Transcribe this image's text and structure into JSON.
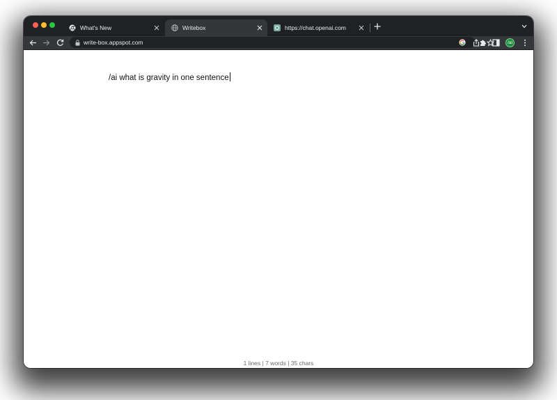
{
  "window": {
    "traffic_colors": {
      "close": "#ff5f57",
      "minimize": "#febc2e",
      "zoom": "#28c840"
    }
  },
  "tabs": [
    {
      "title": "What's New",
      "icon": "chrome-icon",
      "active": false
    },
    {
      "title": "Writebox",
      "icon": "globe-icon",
      "active": true
    },
    {
      "title": "https://chat.openai.com",
      "icon": "openai-icon",
      "active": false
    }
  ],
  "toolbar": {
    "url": "write-box.appspot.com",
    "avatar_label": "/ai",
    "icons": [
      "back-icon",
      "forward-icon",
      "reload-icon",
      "lock-icon",
      "google-icon",
      "share-icon",
      "star-icon",
      "extensions-icon",
      "side-panel-icon",
      "menu-icon"
    ]
  },
  "editor": {
    "text": "/ai what is gravity in one sentence"
  },
  "status": {
    "text": "1 lines | 7 words | 35 chars"
  },
  "colors": {
    "tabstrip_bg": "#202124",
    "toolbar_bg": "#35363a",
    "avatar_bg": "#1e8e3e"
  }
}
